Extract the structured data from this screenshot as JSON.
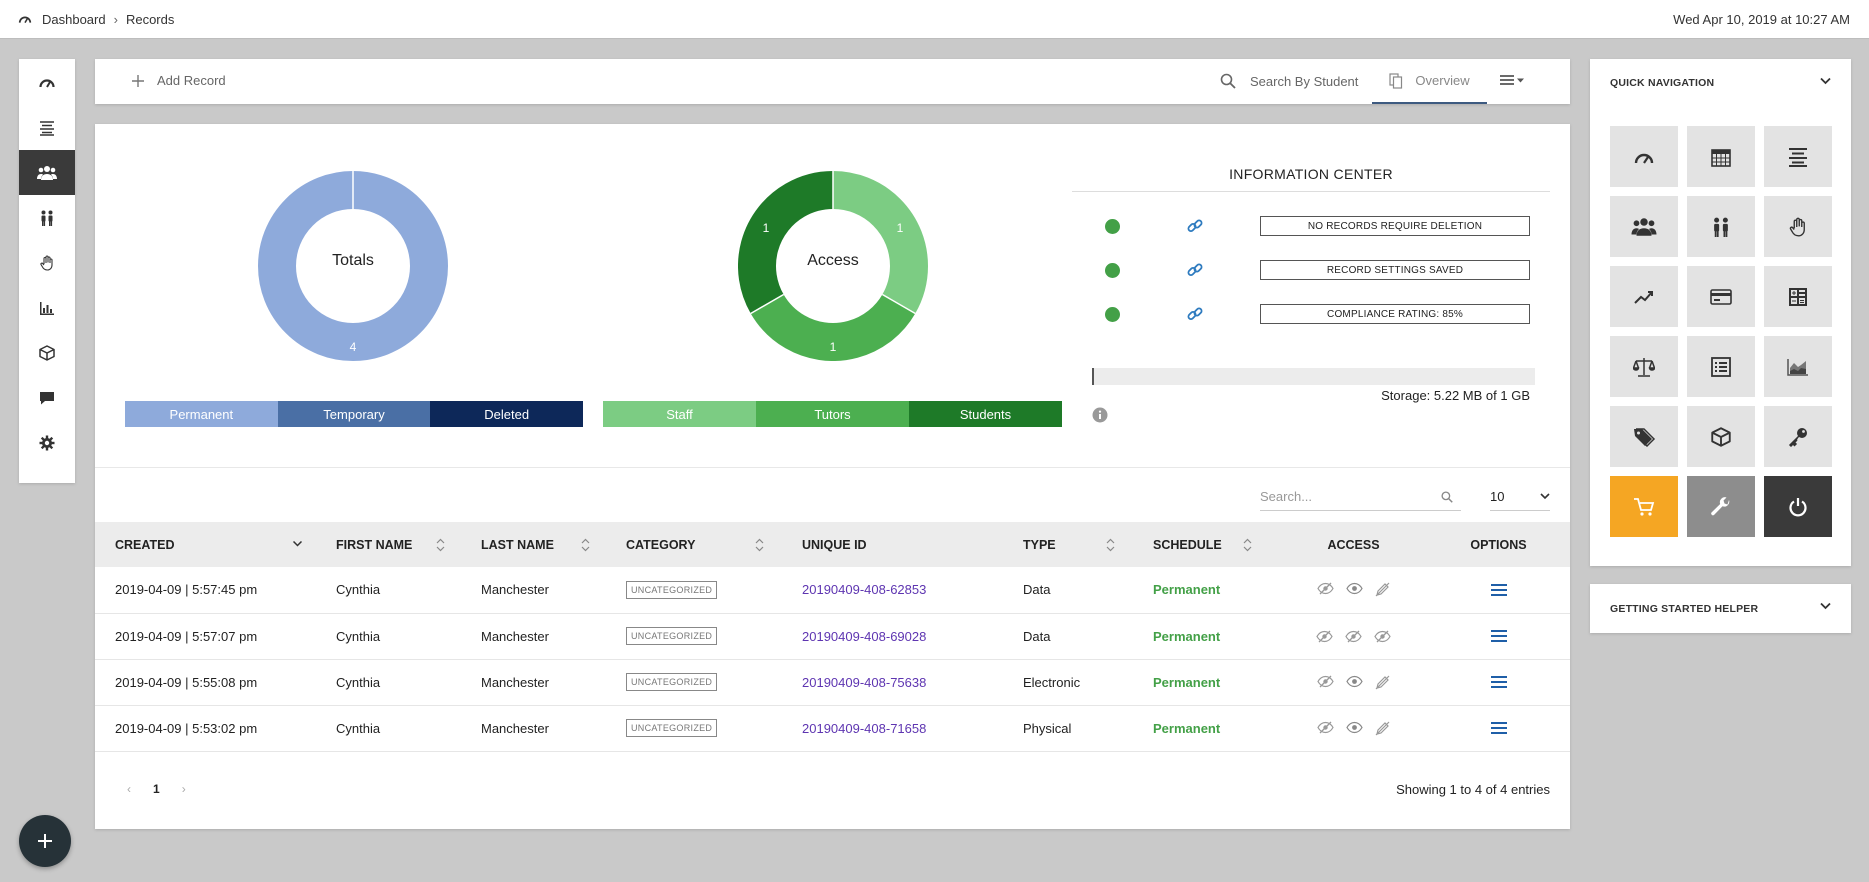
{
  "breadcrumb": {
    "home": "Dashboard",
    "separator": "›",
    "current": "Records"
  },
  "datetime": "Wed Apr 10, 2019 at 10:27 AM",
  "sidebar": {
    "items": [
      {
        "icon": "gauge-icon",
        "active": false
      },
      {
        "icon": "list-icon",
        "active": false
      },
      {
        "icon": "users-icon",
        "active": true
      },
      {
        "icon": "people-icon",
        "active": false
      },
      {
        "icon": "hand-icon",
        "active": false
      },
      {
        "icon": "bar-chart-icon",
        "active": false
      },
      {
        "icon": "box-icon",
        "active": false
      },
      {
        "icon": "chat-icon",
        "active": false
      },
      {
        "icon": "gear-icon",
        "active": false
      }
    ]
  },
  "toolbar": {
    "add_record": "Add Record",
    "search_by_student": "Search By Student",
    "overview": "Overview"
  },
  "totals_chart": {
    "label": "Totals",
    "slice_label": "4",
    "legend": [
      "Permanent",
      "Temporary",
      "Deleted"
    ],
    "colors": [
      "#8eaadb",
      "#4a6fa5",
      "#0d2859"
    ]
  },
  "access_chart": {
    "label": "Access",
    "slice_labels": [
      "1",
      "1",
      "1"
    ],
    "legend": [
      "Staff",
      "Tutors",
      "Students"
    ],
    "colors": [
      "#7ccc83",
      "#4caf50",
      "#1e7a28"
    ]
  },
  "info_center": {
    "title": "INFORMATION CENTER",
    "items": [
      "NO RECORDS REQUIRE DELETION",
      "RECORD SETTINGS SAVED",
      "COMPLIANCE RATING: 85%"
    ],
    "storage": "Storage: 5.22 MB of 1 GB",
    "storage_used_fraction": 0.005
  },
  "table": {
    "search_placeholder": "Search...",
    "page_size": "10",
    "headers": [
      "CREATED",
      "FIRST NAME",
      "LAST NAME",
      "CATEGORY",
      "UNIQUE ID",
      "TYPE",
      "SCHEDULE",
      "ACCESS",
      "OPTIONS"
    ],
    "rows": [
      {
        "created": "2019-04-09 | 5:57:45 pm",
        "first": "Cynthia",
        "last": "Manchester",
        "category": "UNCATEGORIZED",
        "uid": "20190409-408-62853",
        "type": "Data",
        "schedule": "Permanent"
      },
      {
        "created": "2019-04-09 | 5:57:07 pm",
        "first": "Cynthia",
        "last": "Manchester",
        "category": "UNCATEGORIZED",
        "uid": "20190409-408-69028",
        "type": "Data",
        "schedule": "Permanent"
      },
      {
        "created": "2019-04-09 | 5:55:08 pm",
        "first": "Cynthia",
        "last": "Manchester",
        "category": "UNCATEGORIZED",
        "uid": "20190409-408-75638",
        "type": "Electronic",
        "schedule": "Permanent"
      },
      {
        "created": "2019-04-09 | 5:53:02 pm",
        "first": "Cynthia",
        "last": "Manchester",
        "category": "UNCATEGORIZED",
        "uid": "20190409-408-71658",
        "type": "Physical",
        "schedule": "Permanent"
      }
    ],
    "pager": {
      "prev": "‹",
      "current": "1",
      "next": "›"
    },
    "showing": "Showing 1 to 4 of 4 entries"
  },
  "quick_nav": {
    "title": "QUICK NAVIGATION",
    "tiles": [
      "gauge-icon",
      "calendar-icon",
      "list-icon",
      "users-icon",
      "people-icon",
      "hand-icon",
      "trend-icon",
      "card-icon",
      "calculator-icon",
      "scale-icon",
      "ledger-icon",
      "area-chart-icon",
      "tag-icon",
      "box-icon",
      "key-icon",
      "cart-icon",
      "wrench-icon",
      "power-icon"
    ]
  },
  "getting_started": {
    "title": "GETTING STARTED HELPER"
  },
  "colors": {
    "accent": "#3d5a80",
    "orange": "#f5a623",
    "green": "#43a047",
    "purple": "#5e35b1"
  }
}
